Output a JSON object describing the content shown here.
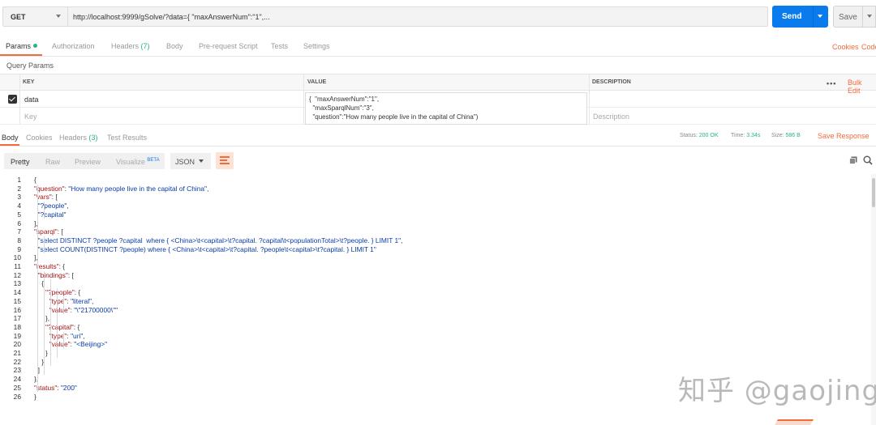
{
  "request": {
    "method": "GET",
    "url": "http://localhost:9999/gSolve/?data={  \"maxAnswerNum\":\"1\",...",
    "send_label": "Send",
    "save_label": "Save"
  },
  "request_tabs": {
    "params": "Params",
    "authorization": "Authorization",
    "headers": "Headers",
    "headers_count": "(7)",
    "body": "Body",
    "pre_request_script": "Pre-request Script",
    "tests": "Tests",
    "settings": "Settings",
    "cookies": "Cookies",
    "code": "Code"
  },
  "query_params": {
    "label": "Query Params",
    "headers": {
      "key": "KEY",
      "value": "VALUE",
      "description": "DESCRIPTION"
    },
    "bulk_edit": "Bulk Edit",
    "row": {
      "key": "data",
      "value_lines": [
        "{  \"maxAnswerNum\":\"1\",",
        "  \"maxSparqlNum\":\"3\",",
        "  \"question\":\"How many people live in the capital of China\")"
      ]
    },
    "placeholders": {
      "key": "Key",
      "description": "Description"
    }
  },
  "response_tabs": {
    "body": "Body",
    "cookies": "Cookies",
    "headers": "Headers",
    "headers_count": "(3)",
    "test_results": "Test Results"
  },
  "response_status": {
    "status_label": "Status:",
    "status_value": "200 OK",
    "time_label": "Time:",
    "time_value": "3.34s",
    "size_label": "Size:",
    "size_value": "586 B",
    "save_response": "Save Response"
  },
  "response_toolbar": {
    "pretty": "Pretty",
    "raw": "Raw",
    "preview": "Preview",
    "visualize": "Visualize",
    "beta": "BETA",
    "format": "JSON"
  },
  "code_lines": [
    "{",
    "    \"question\": \"How many people live in the capital of China\",",
    "    \"vars\": [",
    "        \"?people\",",
    "        \"?capital\"",
    "    ],",
    "    \"sparql\": [",
    "        \"select DISTINCT ?people ?capital  where { <China>\\t<capital>\\t?capital. ?capital\\t<populationTotal>\\t?people. } LIMIT 1\",",
    "        \"select COUNT(DISTINCT ?people) where { <China>\\t<capital>\\t?capital. ?people\\t<capital>\\t?capital. } LIMIT 1\"",
    "    ],",
    "    \"results\": {",
    "        \"bindings\": [",
    "            {",
    "                \"?people\": {",
    "                    \"type\": \"literal\",",
    "                    \"value\": \"\\\"21700000\\\"\"",
    "                },",
    "                \"?capital\": {",
    "                    \"type\": \"uri\",",
    "                    \"value\": \"<Beijing>\"",
    "                }",
    "            }",
    "        ]",
    "    },",
    "    \"status\": \"200\"",
    "}"
  ],
  "watermark": "知乎 @gaojing",
  "colors": {
    "accent": "#f26b3a",
    "send": "#097bed",
    "ok": "#26b47f",
    "json_key": "#a3151a",
    "json_string": "#0a3ca5"
  }
}
